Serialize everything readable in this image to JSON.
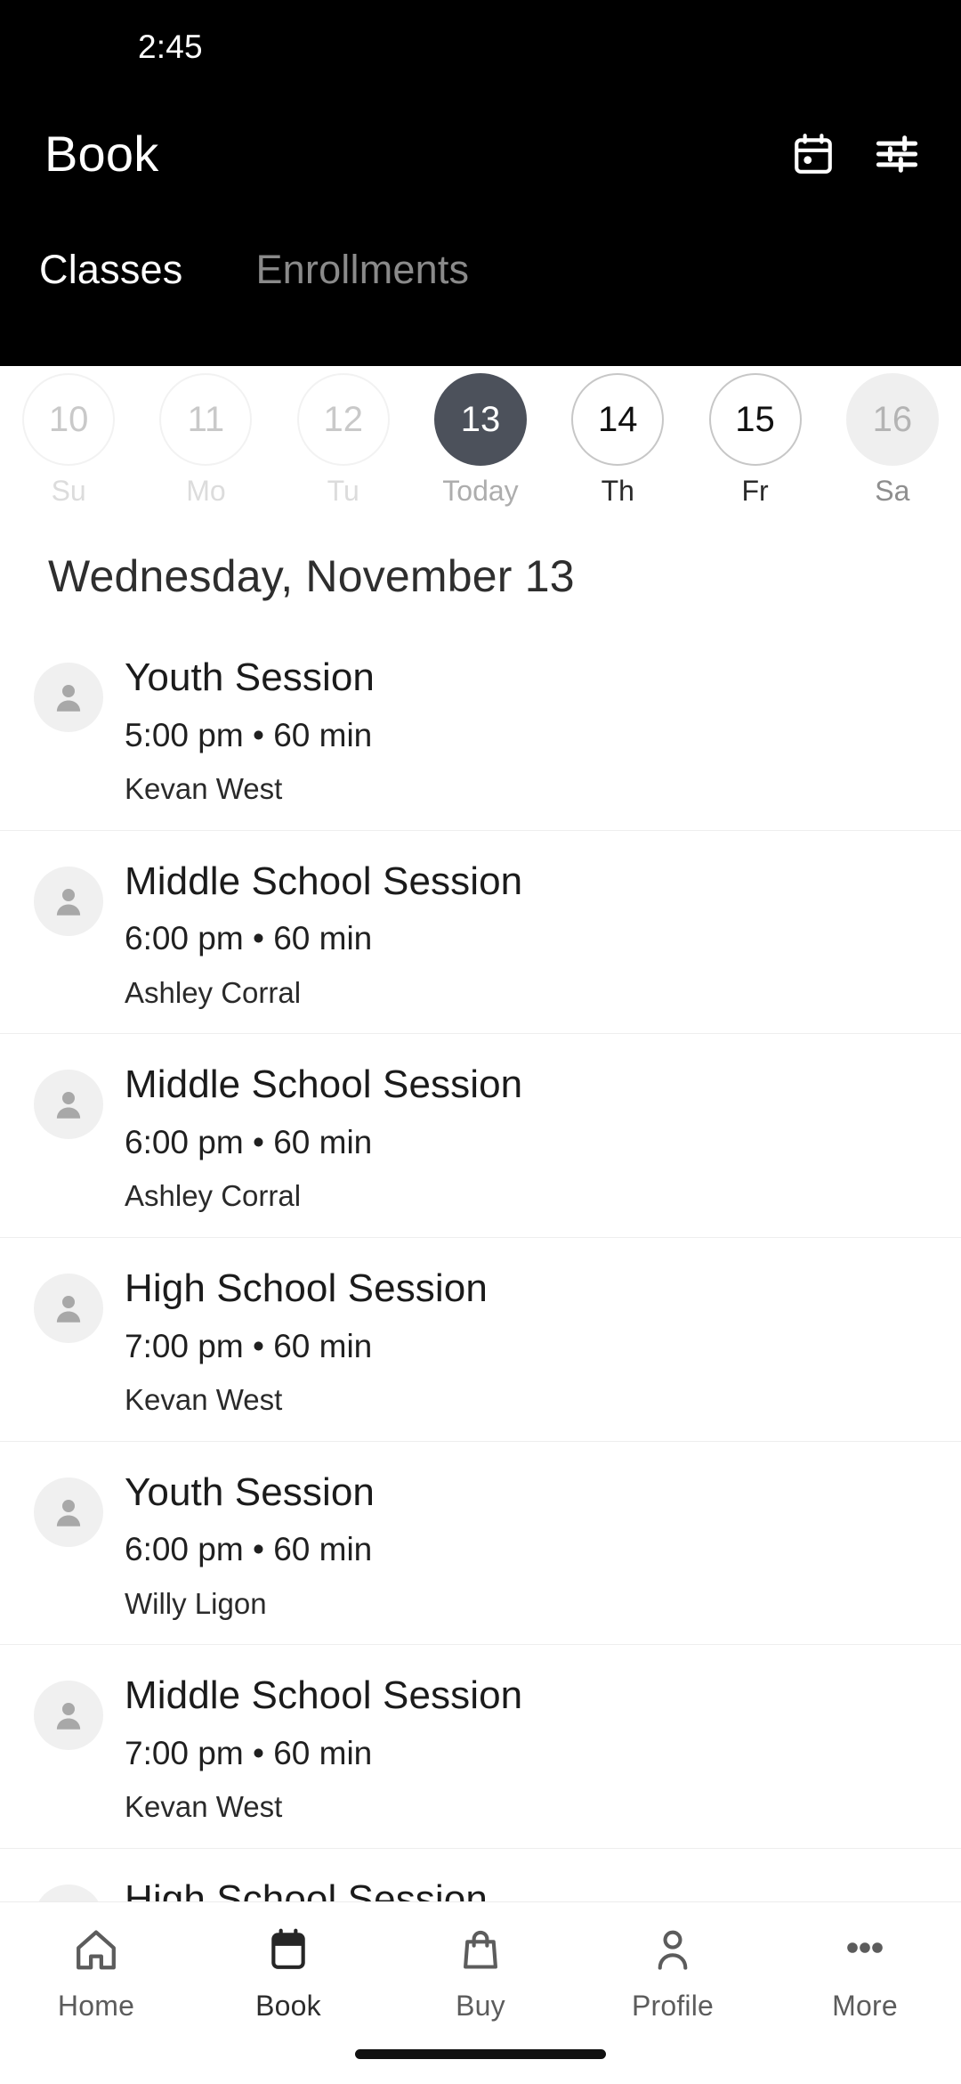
{
  "status_bar": {
    "time": "2:45"
  },
  "header": {
    "title": "Book",
    "calendar_icon": "calendar-icon",
    "filter_icon": "filter-sliders-icon",
    "tabs": [
      {
        "label": "Classes",
        "active": true
      },
      {
        "label": "Enrollments",
        "active": false
      }
    ]
  },
  "date_strip": [
    {
      "day": "10",
      "weekday": "Su",
      "state": "past"
    },
    {
      "day": "11",
      "weekday": "Mo",
      "state": "past"
    },
    {
      "day": "12",
      "weekday": "Tu",
      "state": "past"
    },
    {
      "day": "13",
      "weekday": "Today",
      "state": "selected"
    },
    {
      "day": "14",
      "weekday": "Th",
      "state": "future"
    },
    {
      "day": "15",
      "weekday": "Fr",
      "state": "future"
    },
    {
      "day": "16",
      "weekday": "Sa",
      "state": "muted"
    }
  ],
  "date_heading": "Wednesday, November 13",
  "sessions": [
    {
      "title": "Youth Session",
      "meta": "5:00 pm • 60 min",
      "instructor": "Kevan West"
    },
    {
      "title": "Middle School Session",
      "meta": "6:00 pm • 60 min",
      "instructor": "Ashley Corral"
    },
    {
      "title": "Middle School Session",
      "meta": "6:00 pm • 60 min",
      "instructor": "Ashley Corral"
    },
    {
      "title": "High School Session",
      "meta": "7:00 pm • 60 min",
      "instructor": "Kevan West"
    },
    {
      "title": "Youth Session",
      "meta": "6:00 pm • 60 min",
      "instructor": "Willy Ligon"
    },
    {
      "title": "Middle School Session",
      "meta": "7:00 pm • 60 min",
      "instructor": "Kevan West"
    },
    {
      "title": "High School Session",
      "meta": "",
      "instructor": ""
    }
  ],
  "bottom_nav": [
    {
      "label": "Home",
      "icon": "home-icon",
      "active": false
    },
    {
      "label": "Book",
      "icon": "calendar-icon",
      "active": true
    },
    {
      "label": "Buy",
      "icon": "bag-icon",
      "active": false
    },
    {
      "label": "Profile",
      "icon": "person-icon",
      "active": false
    },
    {
      "label": "More",
      "icon": "more-dots-icon",
      "active": false
    }
  ],
  "colors": {
    "header_bg": "#000000",
    "selected_day": "#4c515b",
    "page_bg": "#ffffff",
    "divider": "#eeeeee"
  }
}
